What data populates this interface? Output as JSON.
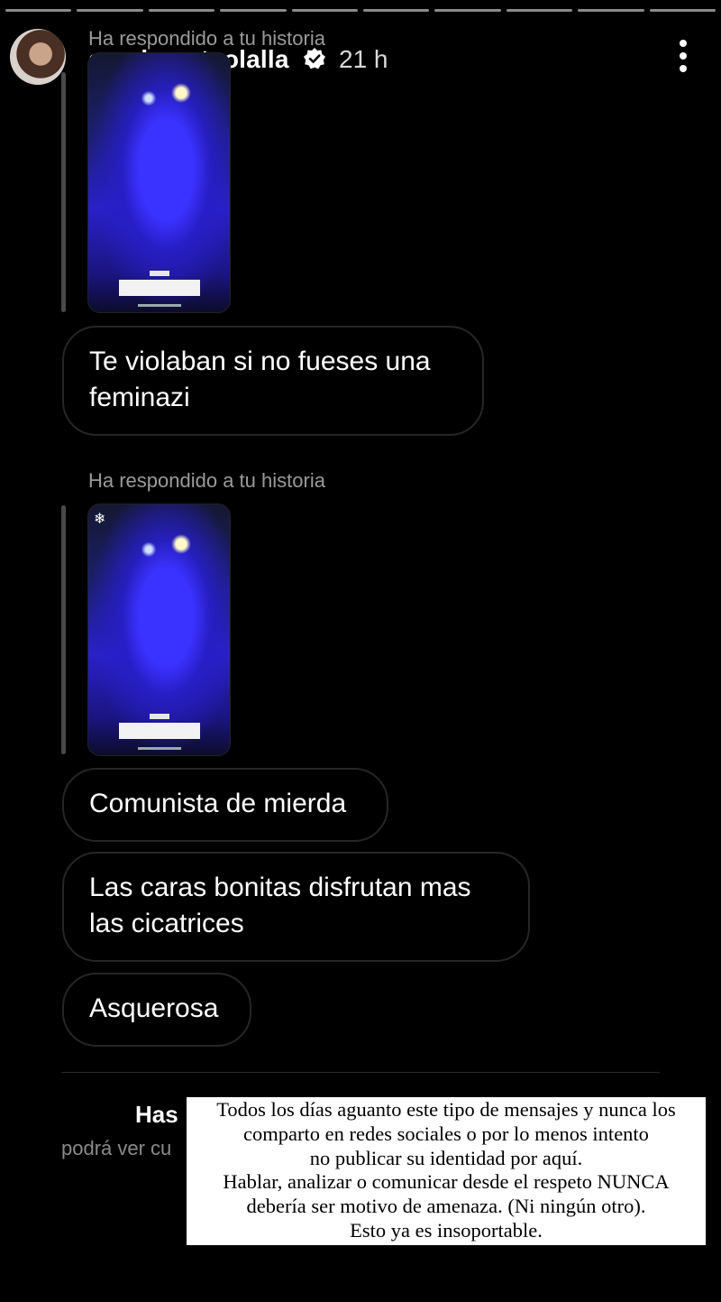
{
  "header": {
    "subtitle": "Ha respondido a tu historia",
    "username": "sarahsantaolalla",
    "time": "21 h"
  },
  "icons": {
    "avatar": "profile-photo",
    "verified": "verified-badge-icon",
    "more": "more-vertical-icon"
  },
  "progress_segments": 10,
  "conversation": {
    "reply_label_2": "Ha respondido a tu historia",
    "messages": [
      "Te violaban si no fueses una feminazi",
      "Comunista de mierda",
      "Las caras bonitas disfrutan mas las cicatrices",
      "Asquerosa"
    ]
  },
  "footer": {
    "has": "Has",
    "podra": "podrá ver cu"
  },
  "overlay_note": {
    "lines": [
      "Todos los días aguanto este tipo de mensajes y nunca los",
      "comparto en redes sociales o por lo menos intento",
      "no publicar su identidad por aquí.",
      "Hablar, analizar o comunicar desde el respeto NUNCA",
      "debería ser motivo de amenaza. (Ni ningún otro).",
      "Esto ya es insoportable."
    ]
  },
  "colors": {
    "background": "#000000",
    "secondary_text": "#9a9a9a",
    "bubble_border": "#262626",
    "note_background": "#ffffff"
  }
}
